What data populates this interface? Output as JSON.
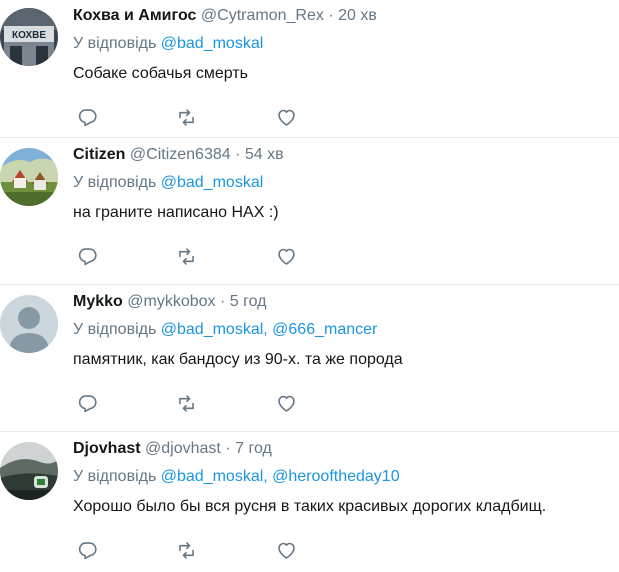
{
  "tweets": [
    {
      "name": "Кохва и Амигос",
      "handle": "@Cytramon_Rex",
      "dot": "·",
      "time": "20 хв",
      "reply_prefix": "У відповідь",
      "mentions": "@bad_moskal",
      "text": "Собаке собачья смерть",
      "avatar_text": "КОХВЕ"
    },
    {
      "name": "Citizen",
      "handle": "@Citizen6384",
      "dot": "·",
      "time": "54 хв",
      "reply_prefix": "У відповідь",
      "mentions": "@bad_moskal",
      "text": "на граните написано НАХ :)"
    },
    {
      "name": "Mykko",
      "handle": "@mykkobox",
      "dot": "·",
      "time": "5 год",
      "reply_prefix": "У відповідь",
      "mentions": "@bad_moskal, @666_mancer",
      "text": "памятник, как бандосу из 90-х. та же порода"
    },
    {
      "name": "Djovhast",
      "handle": "@djovhast",
      "dot": "·",
      "time": "7 год",
      "reply_prefix": "У відповідь",
      "mentions": "@bad_moskal, @herooftheday10",
      "text": "Хорошо было бы вся русня в таких красивых дорогих кладбищ."
    }
  ],
  "icons": {
    "reply": "reply-icon",
    "retweet": "retweet-icon",
    "like": "heart-icon"
  },
  "colors": {
    "name": "#14171a",
    "secondary": "#657786",
    "link": "#1b95e0",
    "divider": "#e6ecf0"
  }
}
